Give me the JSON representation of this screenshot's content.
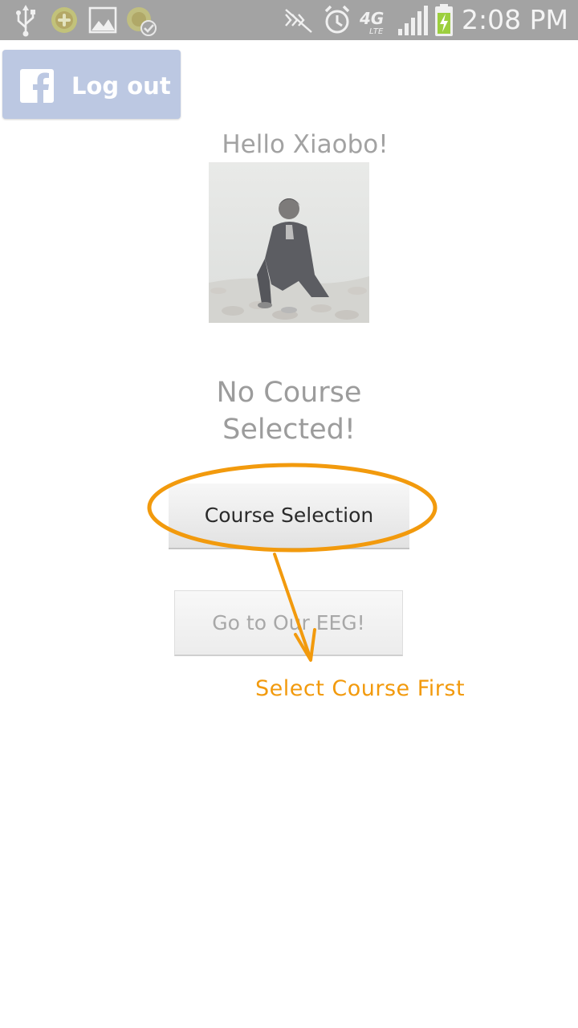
{
  "status_bar": {
    "time": "2:08 PM",
    "network": "4G LTE",
    "icons": [
      "usb-icon",
      "app-notification-icon",
      "gallery-icon",
      "app-sync-icon",
      "no-signal-mute-icon",
      "alarm-icon",
      "4g-lte-icon",
      "signal-bars-icon",
      "battery-charging-icon"
    ]
  },
  "facebook": {
    "logout_label": "Log out",
    "brand_color": "#3b5998"
  },
  "profile": {
    "greeting": "Hello Xiaobo!"
  },
  "course": {
    "status_line1": "No Course",
    "status_line2": "Selected!",
    "selection_button": "Course Selection",
    "eeg_button": "Go to Our EEG!"
  },
  "annotation": {
    "note": "Select Course First",
    "color": "#f29a0d"
  }
}
